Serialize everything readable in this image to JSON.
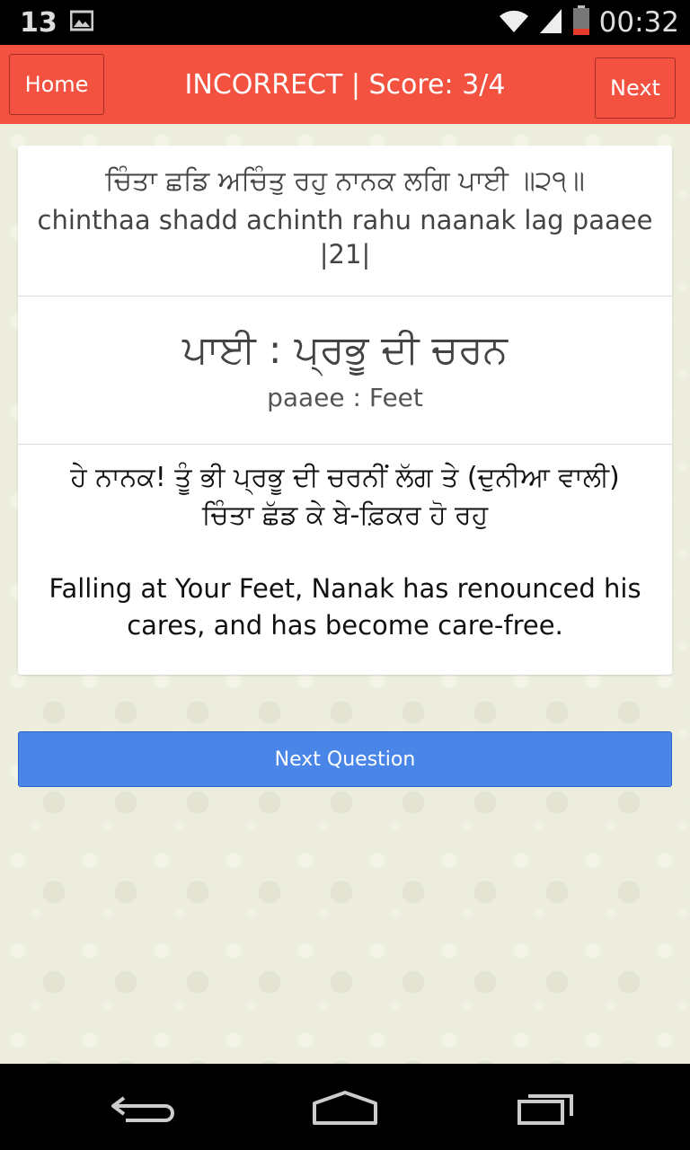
{
  "status_bar": {
    "notification_count": "13",
    "time": "00:32",
    "icons": [
      "image-icon",
      "wifi-icon",
      "signal-icon",
      "battery-icon"
    ]
  },
  "app_bar": {
    "home_label": "Home",
    "title": "INCORRECT | Score: 3/4",
    "next_label": "Next",
    "color": "#f2523f"
  },
  "card": {
    "verse_gurmukhi": "ਚਿੰਤਾ ਛਡਿ ਅਚਿੰਤੁ ਰਹੁ ਨਾਨਕ ਲਗਿ ਪਾਈ ॥੨੧॥",
    "verse_translit_line1": "chinthaa shadd achinth rahu naanak lag paaee",
    "verse_translit_line2": "|21|",
    "word_gurmukhi": "ਪਾਈ : ਪ੍ਰਭੂ ਦੀ ਚਰਨ",
    "word_translit": "paaee : Feet",
    "meaning_gurmukhi_line1": "ਹੇ ਨਾਨਕ! ਤੂੰ ਭੀ ਪ੍ਰਭੂ ਦੀ ਚਰਨੀਂ ਲੱਗ ਤੇ (ਦੁਨੀਆ ਵਾਲੀ)",
    "meaning_gurmukhi_line2": "ਚਿੰਤਾ ਛੱਡ ਕੇ ਬੇ-ਫ਼ਿਕਰ ਹੋ ਰਹੁ",
    "meaning_english_line1": "Falling at Your Feet, Nanak has renounced his",
    "meaning_english_line2": "cares, and has become care-free."
  },
  "next_question_label": "Next Question",
  "next_question_color": "#4a86e8",
  "nav_bar": {
    "icons": [
      "back-icon",
      "home-icon",
      "recent-apps-icon"
    ]
  }
}
